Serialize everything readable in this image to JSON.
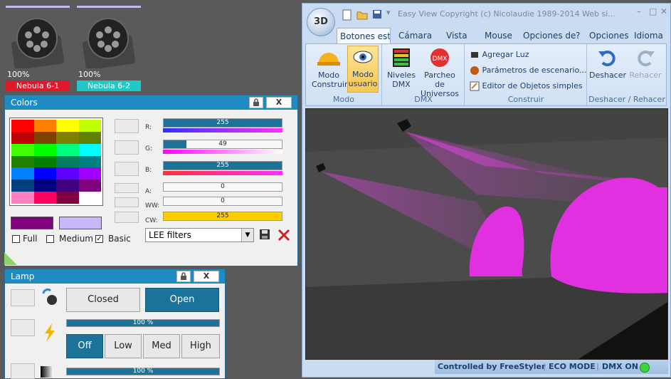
{
  "fixtures": [
    {
      "percent": "100%",
      "name": "Nebula 6-1",
      "color": "#e0182a"
    },
    {
      "percent": "100%",
      "name": "Nebula 6-2",
      "color": "#20c8c8"
    }
  ],
  "colors_panel": {
    "title": "Colors",
    "lock_icon": "lock-icon",
    "close_label": "X",
    "palette": [
      "#ff0000",
      "#ff8000",
      "#ffff00",
      "#c0ff00",
      "#c00000",
      "#804000",
      "#808000",
      "#608000",
      "#40ff00",
      "#00ff00",
      "#00ff80",
      "#00ffff",
      "#208000",
      "#008000",
      "#008060",
      "#008080",
      "#0080ff",
      "#0000ff",
      "#6000ff",
      "#a000ff",
      "#004080",
      "#000080",
      "#400080",
      "#800080",
      "#ff80c0",
      "#ff0060",
      "#800040",
      "#ffffff"
    ],
    "current_color": "#800080",
    "previous_color": "#c8b8ff",
    "sliders": [
      {
        "label": "R:",
        "value": "255",
        "fill": 1.0,
        "fill_color": "#1b7399",
        "grad": "linear-gradient(90deg,#3030ff,#ff30ff)"
      },
      {
        "label": "G:",
        "value": "49",
        "fill": 0.19,
        "fill_color": "#1b7399",
        "grad": "linear-gradient(90deg,#ff00ff,#ffffff)"
      },
      {
        "label": "B:",
        "value": "255",
        "fill": 1.0,
        "fill_color": "#1b7399",
        "grad": "linear-gradient(90deg,#ff3030,#ff30ff)"
      },
      {
        "label": "A:",
        "value": "0",
        "fill": 0.0,
        "fill_color": "#ffcc00",
        "grad": ""
      },
      {
        "label": "WW:",
        "value": "0",
        "fill": 0.0,
        "fill_color": "#ffcc00",
        "grad": ""
      },
      {
        "label": "CW:",
        "value": "255",
        "fill": 1.0,
        "fill_color": "#ffcc00",
        "grad": ""
      }
    ],
    "checks": [
      {
        "label": "Full",
        "checked": false
      },
      {
        "label": "Medium",
        "checked": false
      },
      {
        "label": "Basic",
        "checked": true
      }
    ],
    "filter_select": "LEE filters"
  },
  "lamp_panel": {
    "title": "Lamp",
    "close_label": "X",
    "shutter_closed": "Closed",
    "shutter_open": "Open",
    "dimmer_value": "100 %",
    "dimmer_fill": 1.0,
    "strobe_off": "Off",
    "strobe_low": "Low",
    "strobe_med": "Med",
    "strobe_high": "High",
    "second_value": "100 %"
  },
  "app": {
    "logo": "3D",
    "title_text": "Easy View   Copyright (c) Nicolaudie 1989-2014   Web si...",
    "tabs": [
      "Botones esta",
      "Cámara",
      "Vista",
      "Mouse",
      "Opciones de",
      "?",
      "Opciones",
      "Idioma"
    ],
    "groups": {
      "modo": {
        "title": "Modo",
        "btn1": "Modo Construir",
        "btn2": "Modo usuario"
      },
      "dmx": {
        "title": "DMX",
        "btn1": "Niveles DMX",
        "btn2": "Parcheo de Universos"
      },
      "construir": {
        "title": "Construir",
        "item1": "Agregar Luz",
        "item2": "Parámetros de escenario...",
        "item3": "Editor de Objetos simples"
      },
      "deshacer": {
        "title": "Deshacer / Rehacer",
        "btn1": "Deshacer",
        "btn2": "Rehacer"
      }
    },
    "status": {
      "controlled": "Controlled by FreeStyler",
      "eco": "ECO MODE",
      "dmx": "DMX ON"
    }
  }
}
